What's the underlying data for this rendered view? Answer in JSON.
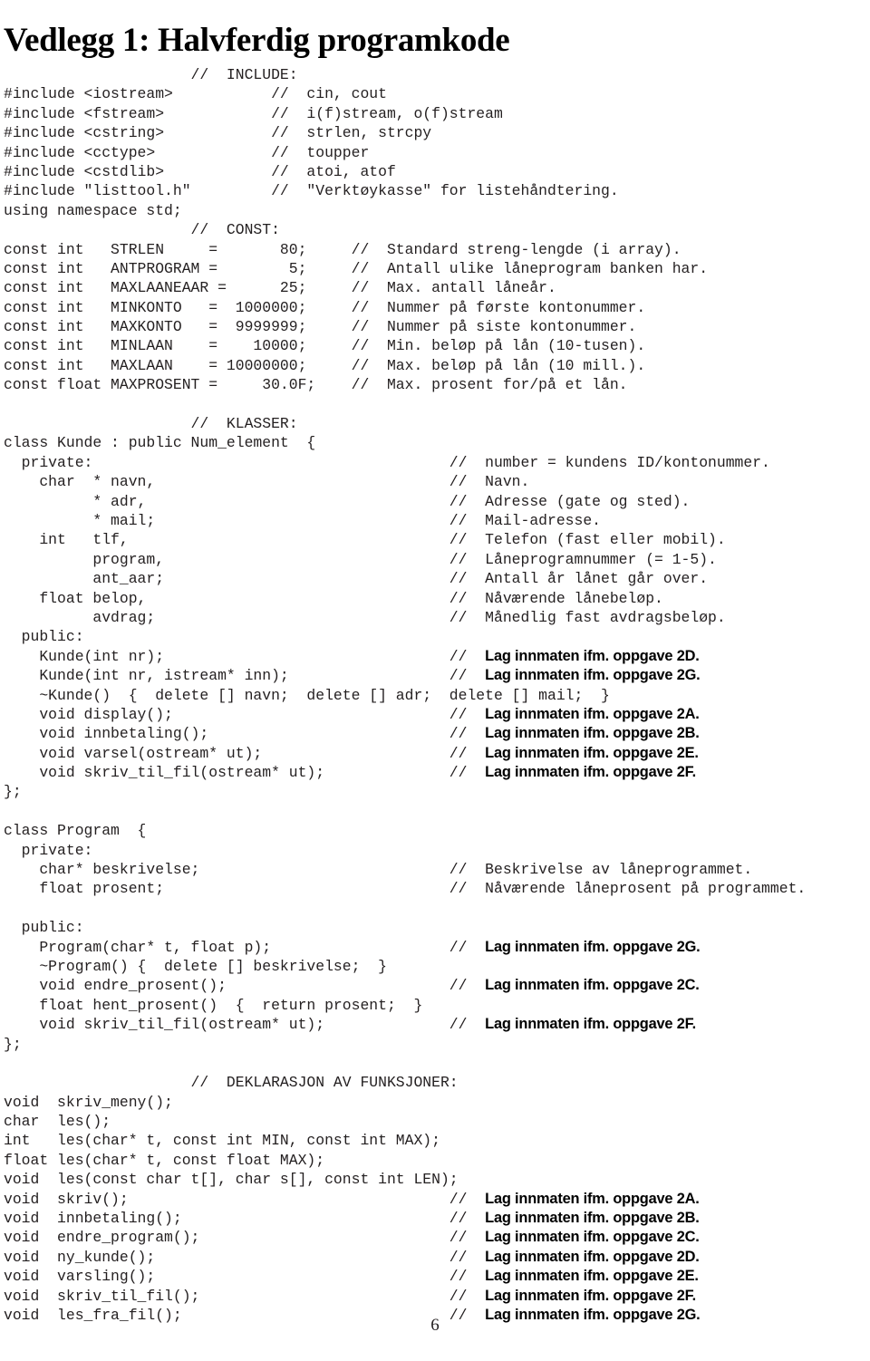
{
  "document": {
    "title": "Vedlegg 1: Halvferdig programkode",
    "page_number": "6"
  },
  "code_listing": {
    "sections": [
      {
        "name": "include",
        "header": "                     //  INCLUDE:",
        "lines": [
          "#include <iostream>           //  cin, cout",
          "#include <fstream>            //  i(f)stream, o(f)stream",
          "#include <cstring>            //  strlen, strcpy",
          "#include <cctype>             //  toupper",
          "#include <cstdlib>            //  atoi, atof",
          "#include \"listtool.h\"         //  \"Verktøykasse\" for listehåndtering.",
          "using namespace std;"
        ]
      },
      {
        "name": "const",
        "header": "                     //  CONST:",
        "lines": [
          "const int   STRLEN     =       80;     //  Standard streng-lengde (i array).",
          "const int   ANTPROGRAM =        5;     //  Antall ulike låneprogram banken har.",
          "const int   MAXLAANEAAR =      25;     //  Max. antall låneår.",
          "const int   MINKONTO   =  1000000;     //  Nummer på første kontonummer.",
          "const int   MAXKONTO   =  9999999;     //  Nummer på siste kontonummer.",
          "const int   MINLAAN    =    10000;     //  Min. beløp på lån (10-tusen).",
          "const int   MAXLAAN    = 10000000;     //  Max. beløp på lån (10 mill.).",
          "const float MAXPROSENT =     30.0F;    //  Max. prosent for/på et lån."
        ]
      },
      {
        "name": "klasser",
        "header": "                     //  KLASSER:",
        "class_kunde": {
          "declaration": "class Kunde : public Num_element  {",
          "private_label": "  private:",
          "private_comment": "//  number = kundens ID/kontonummer.",
          "members": [
            {
              "code": "    char  * navn,",
              "comment": "//  Navn."
            },
            {
              "code": "          * adr,",
              "comment": "//  Adresse (gate og sted)."
            },
            {
              "code": "          * mail;",
              "comment": "//  Mail-adresse."
            },
            {
              "code": "    int   tlf,",
              "comment": "//  Telefon (fast eller mobil)."
            },
            {
              "code": "          program,",
              "comment": "//  Låneprogramnummer (= 1-5)."
            },
            {
              "code": "          ant_aar;",
              "comment": "//  Antall år lånet går over."
            },
            {
              "code": "    float belop,",
              "comment": "//  Nåværende lånebeløp."
            },
            {
              "code": "          avdrag;",
              "comment": "//  Månedlig fast avdragsbeløp."
            }
          ],
          "public_label": "  public:",
          "methods": [
            {
              "code": "    Kunde(int nr);",
              "comment": "//  ",
              "bold": "Lag innmaten ifm. oppgave 2D."
            },
            {
              "code": "    Kunde(int nr, istream* inn);",
              "comment": "//  ",
              "bold": "Lag innmaten ifm. oppgave 2G."
            },
            {
              "code": "    ~Kunde()  {  delete [] navn;  delete [] adr;  delete [] mail;  }",
              "comment": "",
              "bold": ""
            },
            {
              "code": "    void display();",
              "comment": "//  ",
              "bold": "Lag innmaten ifm. oppgave 2A."
            },
            {
              "code": "    void innbetaling();",
              "comment": "//  ",
              "bold": "Lag innmaten ifm. oppgave 2B."
            },
            {
              "code": "    void varsel(ostream* ut);",
              "comment": "//  ",
              "bold": "Lag innmaten ifm. oppgave 2E."
            },
            {
              "code": "    void skriv_til_fil(ostream* ut);",
              "comment": "//  ",
              "bold": "Lag innmaten ifm. oppgave 2F."
            }
          ],
          "close": "};"
        },
        "class_program": {
          "declaration": "class Program  {",
          "private_label": "  private:",
          "members": [
            {
              "code": "    char* beskrivelse;",
              "comment": "//  Beskrivelse av låneprogrammet."
            },
            {
              "code": "    float prosent;",
              "comment": "//  Nåværende låneprosent på programmet."
            }
          ],
          "public_label": "  public:",
          "methods": [
            {
              "code": "    Program(char* t, float p);",
              "comment": "//  ",
              "bold": "Lag innmaten ifm. oppgave 2G."
            },
            {
              "code": "    ~Program() {  delete [] beskrivelse;  }",
              "comment": "",
              "bold": ""
            },
            {
              "code": "    void endre_prosent();",
              "comment": "//  ",
              "bold": "Lag innmaten ifm. oppgave 2C."
            },
            {
              "code": "    float hent_prosent()  {  return prosent;  }",
              "comment": "",
              "bold": ""
            },
            {
              "code": "    void skriv_til_fil(ostream* ut);",
              "comment": "//  ",
              "bold": "Lag innmaten ifm. oppgave 2F."
            }
          ],
          "close": "};"
        }
      },
      {
        "name": "funksjoner",
        "header": "                     //  DEKLARASJON AV FUNKSJONER:",
        "declarations": [
          {
            "code": "void  skriv_meny();",
            "comment": "",
            "bold": ""
          },
          {
            "code": "char  les();",
            "comment": "",
            "bold": ""
          },
          {
            "code": "int   les(char* t, const int MIN, const int MAX);",
            "comment": "",
            "bold": ""
          },
          {
            "code": "float les(char* t, const float MAX);",
            "comment": "",
            "bold": ""
          },
          {
            "code": "void  les(const char t[], char s[], const int LEN);",
            "comment": "",
            "bold": ""
          },
          {
            "code": "void  skriv();",
            "comment": "//  ",
            "bold": "Lag innmaten ifm. oppgave 2A."
          },
          {
            "code": "void  innbetaling();",
            "comment": "//  ",
            "bold": "Lag innmaten ifm. oppgave 2B."
          },
          {
            "code": "void  endre_program();",
            "comment": "//  ",
            "bold": "Lag innmaten ifm. oppgave 2C."
          },
          {
            "code": "void  ny_kunde();",
            "comment": "//  ",
            "bold": "Lag innmaten ifm. oppgave 2D."
          },
          {
            "code": "void  varsling();",
            "comment": "//  ",
            "bold": "Lag innmaten ifm. oppgave 2E."
          },
          {
            "code": "void  skriv_til_fil();",
            "comment": "//  ",
            "bold": "Lag innmaten ifm. oppgave 2F."
          },
          {
            "code": "void  les_fra_fil();",
            "comment": "//  ",
            "bold": "Lag innmaten ifm. oppgave 2G."
          }
        ]
      }
    ]
  }
}
